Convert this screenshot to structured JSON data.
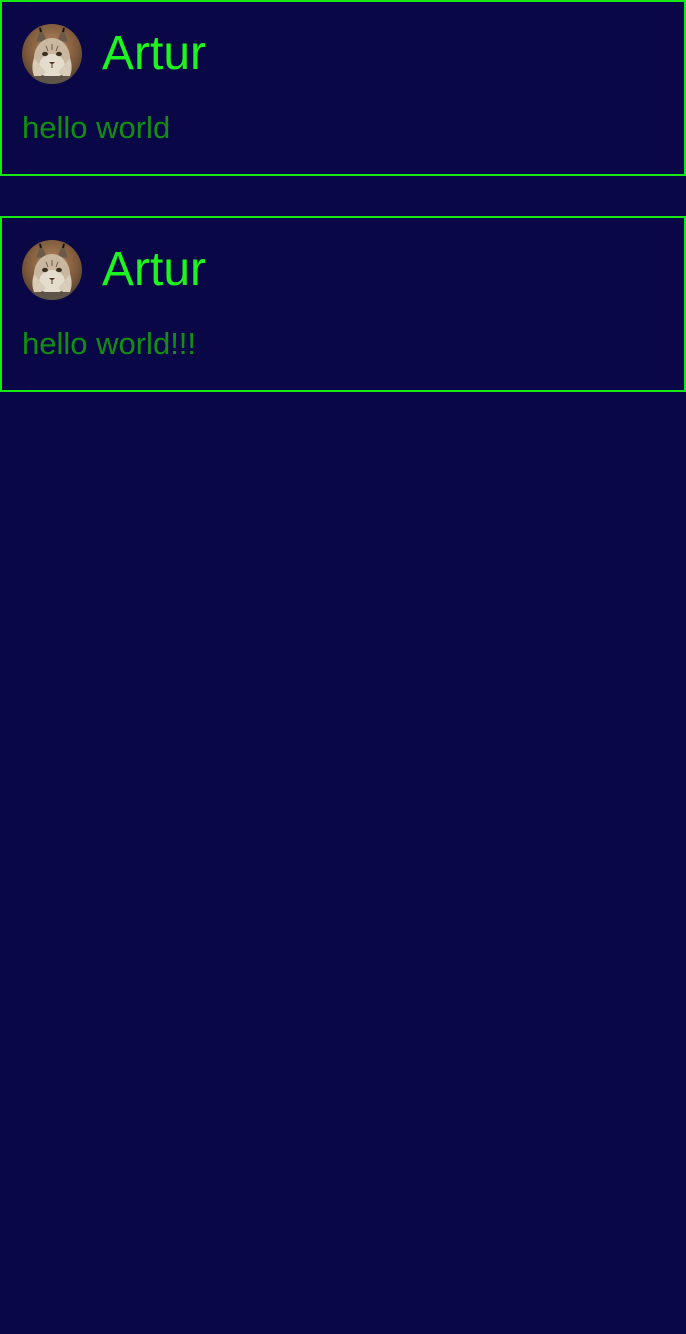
{
  "feed": {
    "posts": [
      {
        "author": "Artur",
        "avatar_icon": "lynx-avatar",
        "text": "hello world"
      },
      {
        "author": "Artur",
        "avatar_icon": "lynx-avatar",
        "text": "hello world!!!"
      }
    ]
  },
  "colors": {
    "background": "#0a0747",
    "border": "#17e817",
    "author": "#1ef51e",
    "text": "#128f12"
  }
}
